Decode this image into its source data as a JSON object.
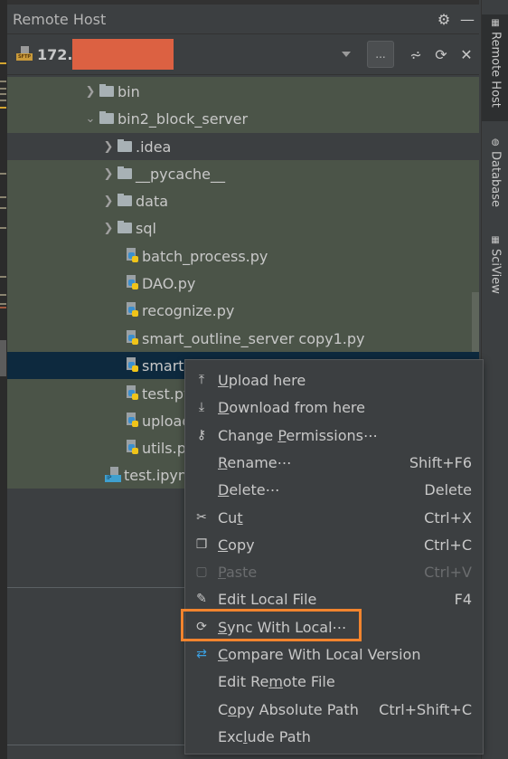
{
  "panel": {
    "title": "Remote Host",
    "header_icons": [
      "gear-icon",
      "minimize-icon"
    ],
    "connection": {
      "host_prefix": "172.",
      "protocol_badge": "SFTP",
      "more_label": "...",
      "toolbar_icons": [
        "collapse-icon",
        "refresh-icon",
        "close-icon"
      ]
    }
  },
  "tree": {
    "rows": [
      {
        "label": "bin",
        "type": "folder",
        "expanded": false,
        "depth": 0
      },
      {
        "label": "bin2_block_server",
        "type": "folder",
        "expanded": true,
        "depth": 0
      },
      {
        "label": ".idea",
        "type": "folder",
        "expanded": false,
        "depth": 1
      },
      {
        "label": "__pycache__",
        "type": "folder",
        "expanded": false,
        "depth": 1
      },
      {
        "label": "data",
        "type": "folder",
        "expanded": false,
        "depth": 1
      },
      {
        "label": "sql",
        "type": "folder",
        "expanded": false,
        "depth": 1
      },
      {
        "label": "batch_process.py",
        "type": "python",
        "depth": 1
      },
      {
        "label": "DAO.py",
        "type": "python",
        "depth": 1
      },
      {
        "label": "recognize.py",
        "type": "python",
        "depth": 1
      },
      {
        "label": "smart_outline_server copy1.py",
        "type": "python",
        "depth": 1
      },
      {
        "label": "smart",
        "type": "python",
        "depth": 1,
        "selected": true
      },
      {
        "label": "test.py",
        "type": "python",
        "depth": 1
      },
      {
        "label": "upload",
        "type": "python",
        "depth": 1
      },
      {
        "label": "utils.py",
        "type": "python",
        "depth": 1
      },
      {
        "label": "test.ipynb",
        "type": "notebook",
        "depth": 0
      }
    ]
  },
  "right_tabs": [
    {
      "label": "Remote Host",
      "icon": "remote-host-icon",
      "active": true
    },
    {
      "label": "Database",
      "icon": "database-icon",
      "active": false
    },
    {
      "label": "SciView",
      "icon": "sciview-icon",
      "active": false
    }
  ],
  "context_menu": {
    "items": [
      {
        "pre": "",
        "u": "U",
        "post": "pload here",
        "shortcut": "",
        "icon": "upload-icon"
      },
      {
        "pre": "",
        "u": "D",
        "post": "ownload from here",
        "shortcut": "",
        "icon": "download-icon"
      },
      {
        "pre": "Change ",
        "u": "P",
        "post": "ermissions⋯",
        "shortcut": "",
        "icon": "key-icon"
      },
      {
        "pre": "",
        "u": "R",
        "post": "ename⋯",
        "shortcut": "Shift+F6",
        "icon": ""
      },
      {
        "pre": "",
        "u": "D",
        "post": "elete⋯",
        "shortcut": "Delete",
        "icon": ""
      },
      {
        "pre": "Cu",
        "u": "t",
        "post": "",
        "shortcut": "Ctrl+X",
        "icon": "scissors-icon"
      },
      {
        "pre": "",
        "u": "C",
        "post": "opy",
        "shortcut": "Ctrl+C",
        "icon": "copy-icon"
      },
      {
        "pre": "",
        "u": "P",
        "post": "aste",
        "shortcut": "Ctrl+V",
        "icon": "paste-icon",
        "disabled": true
      },
      {
        "pre": "Edit Local File",
        "u": "",
        "post": "",
        "shortcut": "F4",
        "icon": "edit-icon"
      },
      {
        "pre": "",
        "u": "S",
        "post": "ync With Local⋯",
        "shortcut": "",
        "icon": "sync-icon",
        "highlighted": true
      },
      {
        "pre": "",
        "u": "C",
        "post": "ompare With Local Version",
        "shortcut": "",
        "icon": "compare-icon"
      },
      {
        "pre": "Edit Re",
        "u": "m",
        "post": "ote File",
        "shortcut": "",
        "icon": ""
      },
      {
        "pre": "C",
        "u": "o",
        "post": "py Absolute Path",
        "shortcut": "Ctrl+Shift+C",
        "icon": ""
      },
      {
        "pre": "Exc",
        "u": "l",
        "post": "ude Path",
        "shortcut": "",
        "icon": ""
      }
    ]
  },
  "colors": {
    "highlight_box": "#f2842e",
    "selection": "#0d293e",
    "tree_bg": "#4b5448",
    "redaction": "#dc6142"
  }
}
